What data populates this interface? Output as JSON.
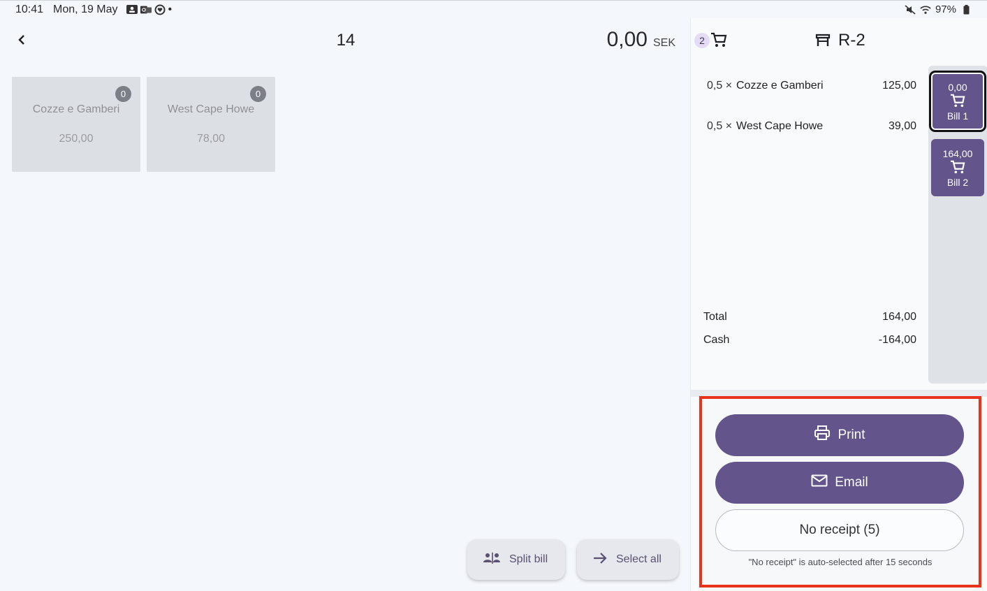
{
  "statusbar": {
    "time": "10:41",
    "date": "Mon, 19 May",
    "dot": "•",
    "battery": "97%"
  },
  "order": {
    "number": "14",
    "amount": "0,00",
    "currency": "SEK"
  },
  "tiles": [
    {
      "name": "Cozze e Gamberi",
      "price": "250,00",
      "count": "0"
    },
    {
      "name": "West Cape Howe",
      "price": "78,00",
      "count": "0"
    }
  ],
  "actions": {
    "split_bill": "Split bill",
    "select_all": "Select all"
  },
  "cart": {
    "count": "2",
    "table": "R-2",
    "lines": [
      {
        "qty": "0,5 ×",
        "name": "Cozze e Gamberi",
        "price": "125,00"
      },
      {
        "qty": "0,5 ×",
        "name": "West Cape Howe",
        "price": "39,00"
      }
    ],
    "total_label": "Total",
    "total_value": "164,00",
    "cash_label": "Cash",
    "cash_value": "-164,00"
  },
  "bills": [
    {
      "amount": "0,00",
      "label": "Bill 1",
      "selected": true
    },
    {
      "amount": "164,00",
      "label": "Bill 2",
      "selected": false
    }
  ],
  "receipt": {
    "print": "Print",
    "email": "Email",
    "no_receipt": "No receipt (5)",
    "hint": "\"No receipt\" is auto-selected after 15 seconds"
  },
  "colors": {
    "accent": "#63558c",
    "highlight_border": "#e8341c"
  }
}
